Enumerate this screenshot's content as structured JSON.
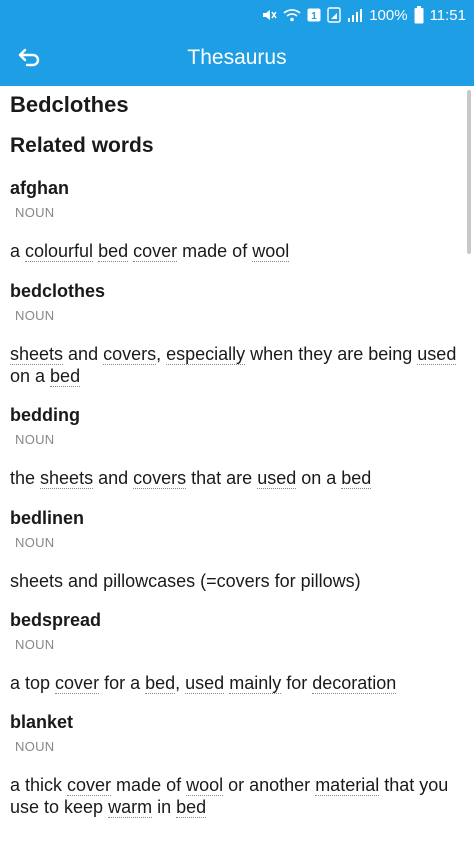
{
  "status_bar": {
    "battery_percent": "100%",
    "time": "11:51",
    "notification_badge": "1",
    "icons": [
      "mute-icon",
      "wifi-icon",
      "notification-icon",
      "sim-icon",
      "signal-icon",
      "battery-icon"
    ]
  },
  "app_bar": {
    "title": "Thesaurus",
    "back_icon": "back-arrow-icon",
    "color": "#1e9ee4"
  },
  "page": {
    "title": "Bedclothes",
    "section_title": "Related words"
  },
  "entries": [
    {
      "word": "afghan",
      "pos": "NOUN",
      "definition": [
        {
          "text": "a ",
          "link": false
        },
        {
          "text": "colourful",
          "link": true
        },
        {
          "text": " ",
          "link": false
        },
        {
          "text": "bed",
          "link": true
        },
        {
          "text": " ",
          "link": false
        },
        {
          "text": "cover",
          "link": true
        },
        {
          "text": " made of ",
          "link": false
        },
        {
          "text": "wool",
          "link": true
        }
      ]
    },
    {
      "word": "bedclothes",
      "pos": "NOUN",
      "definition": [
        {
          "text": "sheets",
          "link": true
        },
        {
          "text": " and ",
          "link": false
        },
        {
          "text": "covers",
          "link": true
        },
        {
          "text": ", ",
          "link": false
        },
        {
          "text": "especially",
          "link": true
        },
        {
          "text": " when they are being ",
          "link": false
        },
        {
          "text": "used",
          "link": true
        },
        {
          "text": " on a ",
          "link": false
        },
        {
          "text": "bed",
          "link": true
        }
      ]
    },
    {
      "word": "bedding",
      "pos": "NOUN",
      "definition": [
        {
          "text": "the ",
          "link": false
        },
        {
          "text": "sheets",
          "link": true
        },
        {
          "text": " and ",
          "link": false
        },
        {
          "text": "covers",
          "link": true
        },
        {
          "text": " that are ",
          "link": false
        },
        {
          "text": "used",
          "link": true
        },
        {
          "text": " on a ",
          "link": false
        },
        {
          "text": "bed",
          "link": true
        }
      ]
    },
    {
      "word": "bedlinen",
      "pos": "NOUN",
      "definition": [
        {
          "text": "sheets and pillowcases (=covers for pillows)",
          "link": false
        }
      ]
    },
    {
      "word": "bedspread",
      "pos": "NOUN",
      "definition": [
        {
          "text": "a top ",
          "link": false
        },
        {
          "text": "cover",
          "link": true
        },
        {
          "text": " for a ",
          "link": false
        },
        {
          "text": "bed",
          "link": true
        },
        {
          "text": ", ",
          "link": false
        },
        {
          "text": "used",
          "link": true
        },
        {
          "text": " ",
          "link": false
        },
        {
          "text": "mainly",
          "link": true
        },
        {
          "text": " for ",
          "link": false
        },
        {
          "text": "decoration",
          "link": true
        }
      ]
    },
    {
      "word": "blanket",
      "pos": "NOUN",
      "definition": [
        {
          "text": "a thick ",
          "link": false
        },
        {
          "text": "cover",
          "link": true
        },
        {
          "text": " made of ",
          "link": false
        },
        {
          "text": "wool",
          "link": true
        },
        {
          "text": " or another ",
          "link": false
        },
        {
          "text": "material",
          "link": true
        },
        {
          "text": " that you use to keep ",
          "link": false
        },
        {
          "text": "warm",
          "link": true
        },
        {
          "text": " in ",
          "link": false
        },
        {
          "text": "bed",
          "link": true
        }
      ]
    }
  ]
}
